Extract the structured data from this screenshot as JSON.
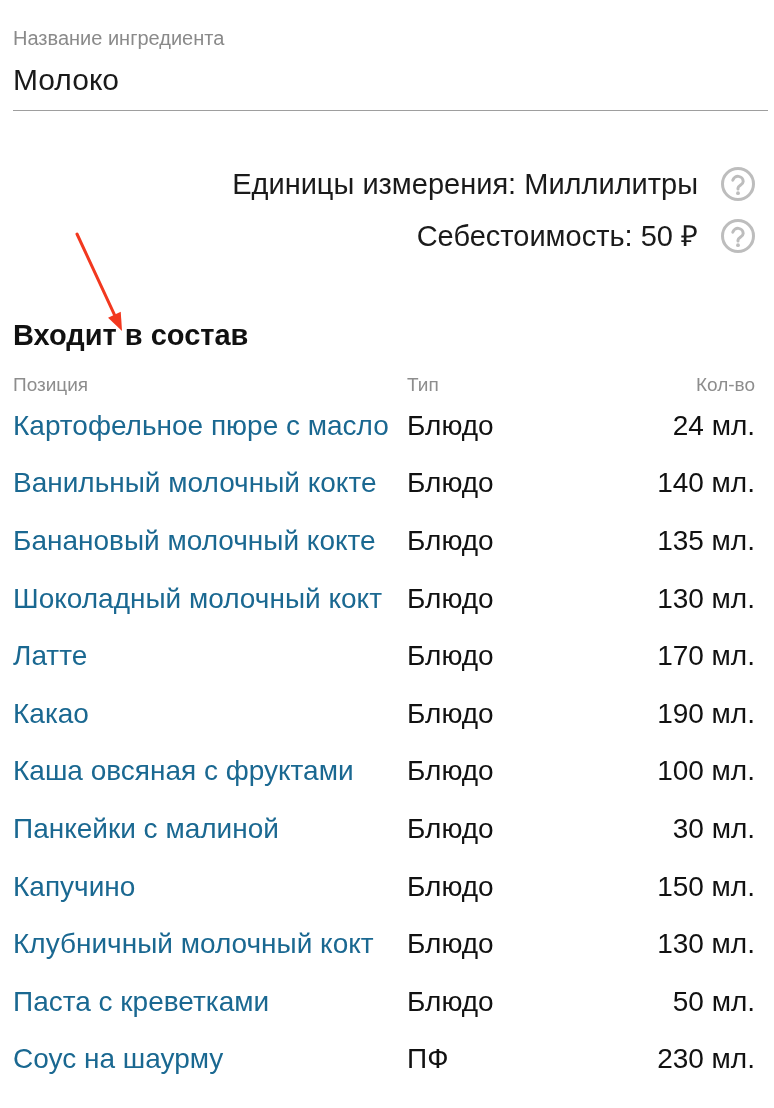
{
  "field": {
    "label": "Название ингредиента",
    "value": "Молоко"
  },
  "properties": [
    {
      "text": "Единицы измерения: Миллилитры",
      "help": true
    },
    {
      "text": "Себестоимость: 50 ₽",
      "help": true
    }
  ],
  "section": {
    "title": "Входит в состав",
    "columns": [
      "Позиция",
      "Тип",
      "Кол-во"
    ],
    "rows": [
      {
        "position": "Картофельное пюре с масло",
        "type": "Блюдо",
        "amount": "24 мл."
      },
      {
        "position": "Ванильный молочный кокте",
        "type": "Блюдо",
        "amount": "140 мл."
      },
      {
        "position": "Банановый молочный кокте",
        "type": "Блюдо",
        "amount": "135 мл."
      },
      {
        "position": "Шоколадный молочный кокт",
        "type": "Блюдо",
        "amount": "130 мл."
      },
      {
        "position": "Латте",
        "type": "Блюдо",
        "amount": "170 мл."
      },
      {
        "position": "Какао",
        "type": "Блюдо",
        "amount": "190 мл."
      },
      {
        "position": "Каша овсяная с фруктами",
        "type": "Блюдо",
        "amount": "100 мл."
      },
      {
        "position": "Панкейки с малиной",
        "type": "Блюдо",
        "amount": "30 мл."
      },
      {
        "position": "Капучино",
        "type": "Блюдо",
        "amount": "150 мл."
      },
      {
        "position": "Клубничный молочный кокт",
        "type": "Блюдо",
        "amount": "130 мл."
      },
      {
        "position": "Паста с креветками",
        "type": "Блюдо",
        "amount": "50 мл."
      },
      {
        "position": "Соус на шаурму",
        "type": "ПФ",
        "amount": "230 мл."
      }
    ]
  }
}
